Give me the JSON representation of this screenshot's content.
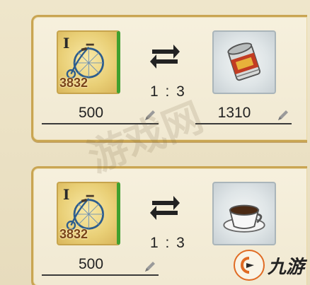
{
  "trades": [
    {
      "give": {
        "item": "penny-farthing bicycle",
        "tier": "I",
        "count": "3832",
        "amount": "500"
      },
      "receive": {
        "item": "canned food",
        "amount": "1310"
      },
      "ratio": "1 : 3"
    },
    {
      "give": {
        "item": "penny-farthing bicycle",
        "tier": "I",
        "count": "3832",
        "amount": "500"
      },
      "receive": {
        "item": "coffee cup",
        "amount": ""
      },
      "ratio": "1 : 3"
    }
  ],
  "watermark": {
    "text": "游戏网"
  },
  "brand": {
    "text": "九游"
  },
  "icons": {
    "swap": "swap-arrows-icon",
    "edit": "pencil-icon",
    "bicycle": "bicycle-icon",
    "can": "canned-food-icon",
    "coffee": "coffee-cup-icon",
    "logo": "jiuyou-logo-icon"
  },
  "colors": {
    "frame_gold": "#c9a552",
    "card_bg": "#f4eddb",
    "tier_bar_green": "#3fa02f",
    "count_brown": "#7a4418",
    "logo_orange": "#e06b23"
  }
}
